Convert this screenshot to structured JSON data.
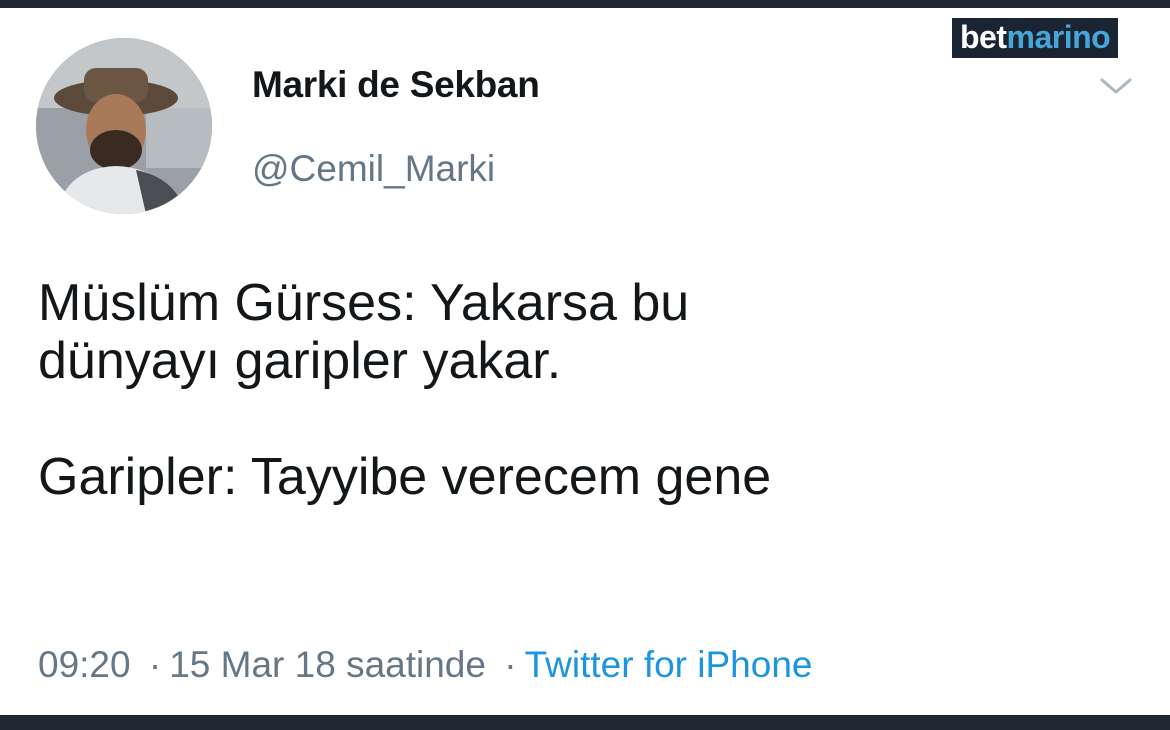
{
  "author": {
    "display_name": "Marki de Sekban",
    "handle": "@Cemil_Marki"
  },
  "brand_watermark": {
    "part1": "bet",
    "part2": "marino"
  },
  "tweet": {
    "text": "Müslüm Gürses: Yakarsa bu\ndünyayı garipler yakar.\n\nGaripler: Tayyibe verecem gene",
    "time": "09:20",
    "date": "15 Mar 18 saatinde",
    "separator": "·",
    "client": "Twitter for iPhone"
  },
  "icons": {
    "menu": "chevron-down-icon",
    "avatar": "profile-photo"
  },
  "colors": {
    "text_primary": "#14171a",
    "text_secondary": "#657786",
    "link": "#1b95e0",
    "background": "#ffffff",
    "frame": "#1f2733"
  }
}
